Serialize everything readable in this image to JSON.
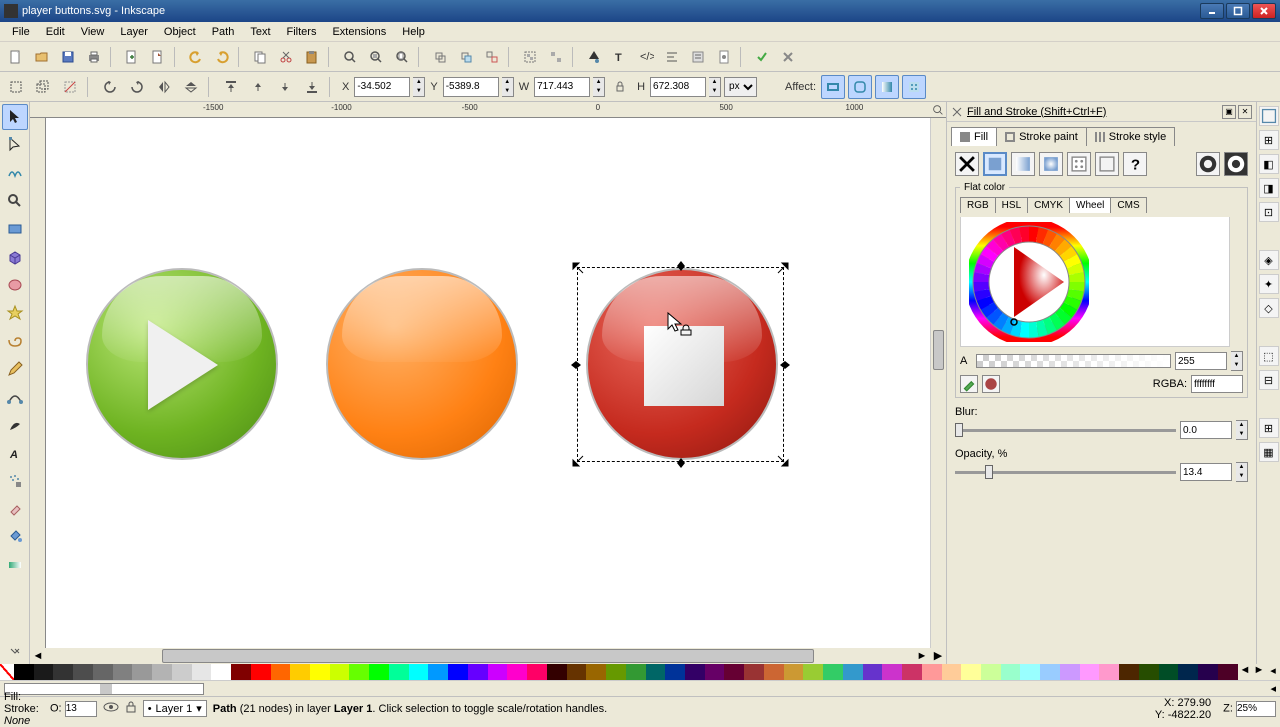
{
  "window": {
    "title": "player buttons.svg - Inkscape"
  },
  "menu": [
    "File",
    "Edit",
    "View",
    "Layer",
    "Object",
    "Path",
    "Text",
    "Filters",
    "Extensions",
    "Help"
  ],
  "toolopts": {
    "x_label": "X",
    "x": "-34.502",
    "y_label": "Y",
    "y": "-5389.8",
    "w_label": "W",
    "w": "717.443",
    "h_label": "H",
    "h": "672.308",
    "unit": "px",
    "affect_label": "Affect:"
  },
  "ruler_ticks": [
    "-1500",
    "-1000",
    "-500",
    "0",
    "500",
    "1000"
  ],
  "panel": {
    "title": "Fill and Stroke (Shift+Ctrl+F)",
    "tabs": {
      "fill": "Fill",
      "stroke": "Stroke paint",
      "style": "Stroke style"
    },
    "flatcolor_label": "Flat color",
    "colortabs": [
      "RGB",
      "HSL",
      "CMYK",
      "Wheel",
      "CMS"
    ],
    "alpha_label": "A",
    "alpha": "255",
    "rgba_label": "RGBA:",
    "rgba": "ffffffff",
    "blur_label": "Blur:",
    "blur": "0.0",
    "opacity_label": "Opacity, %",
    "opacity": "13.4"
  },
  "status": {
    "fill_label": "Fill:",
    "stroke_label": "Stroke:",
    "stroke_val": "None",
    "o_label": "O:",
    "o_val": "13",
    "layer": "Layer 1",
    "hint_type": "Path",
    "hint_nodes": "(21 nodes)",
    "hint_rest_a": " in layer ",
    "hint_layer": "Layer 1",
    "hint_rest_b": ". Click selection to toggle scale/rotation handles.",
    "x_label": "X:",
    "x": "279.90",
    "y_label": "Y:",
    "y": "-4822.20",
    "z_label": "Z:",
    "z": "25%"
  },
  "palette": [
    "#000000",
    "#1a1a1a",
    "#333333",
    "#4d4d4d",
    "#666666",
    "#808080",
    "#999999",
    "#b3b3b3",
    "#cccccc",
    "#e6e6e6",
    "#ffffff",
    "#800000",
    "#ff0000",
    "#ff6600",
    "#ffcc00",
    "#ffff00",
    "#ccff00",
    "#66ff00",
    "#00ff00",
    "#00ff99",
    "#00ffff",
    "#0099ff",
    "#0000ff",
    "#6600ff",
    "#cc00ff",
    "#ff00cc",
    "#ff0066",
    "#330000",
    "#663300",
    "#996600",
    "#669900",
    "#339933",
    "#006666",
    "#003399",
    "#330066",
    "#660066",
    "#660033",
    "#993333",
    "#cc6633",
    "#cc9933",
    "#99cc33",
    "#33cc66",
    "#3399cc",
    "#6633cc",
    "#cc33cc",
    "#cc3366",
    "#ff9999",
    "#ffcc99",
    "#ffff99",
    "#ccff99",
    "#99ffcc",
    "#99ffff",
    "#99ccff",
    "#cc99ff",
    "#ff99ff",
    "#ff99cc",
    "#4d2600",
    "#264d00",
    "#004d26",
    "#00264d",
    "#26004d",
    "#4d0026"
  ]
}
